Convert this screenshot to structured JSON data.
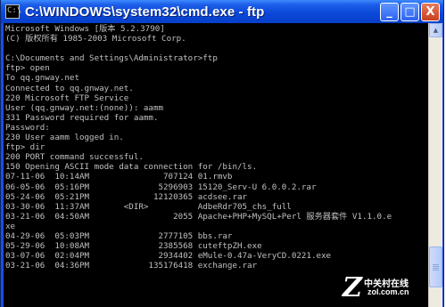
{
  "window": {
    "title": "C:\\WINDOWS\\system32\\cmd.exe - ftp",
    "icon_glyph": "C:\\",
    "minimize_symbol": "_",
    "maximize_symbol": "□",
    "close_symbol": "X"
  },
  "colors": {
    "titlebar": "#0a46d8",
    "console_background": "#000000",
    "console_text": "#c0c0c0",
    "close_button": "#c8401e"
  },
  "console": {
    "lines": [
      "Microsoft Windows [版本 5.2.3790]",
      "(C) 版权所有 1985-2003 Microsoft Corp.",
      "",
      "C:\\Documents and Settings\\Administrator>ftp",
      "ftp> open",
      "To qq.gnway.net",
      "Connected to qq.gnway.net.",
      "220 Microsoft FTP Service",
      "User (qq.gnway.net:(none)): aamm",
      "331 Password required for aamm.",
      "Password:",
      "230 User aamm logged in.",
      "ftp> dir",
      "200 PORT command successful.",
      "150 Opening ASCII mode data connection for /bin/ls.",
      "07-11-06  10:14AM               707124 01.rmvb",
      "06-05-06  05:16PM              5296903 15120_Serv-U 6.0.0.2.rar",
      "05-24-06  05:21PM             12120365 acdsee.rar",
      "03-30-06  11:37AM       <DIR>          AdbeRdr705_chs_full",
      "03-21-06  04:50AM                 2055 Apache+PHP+MySQL+Perl 服务器套件 V1.1.0.e",
      "xe",
      "04-29-06  05:03PM              2777105 bbs.rar",
      "05-29-06  10:08AM              2385568 cuteftpZH.exe",
      "03-07-06  02:04PM              2934402 eMule-0.47a-VeryCD.0221.exe",
      "03-21-06  04:36PM            135176418 exchange.rar"
    ]
  },
  "scrollbar": {
    "up_arrow_icon": "scroll-up-arrow-icon",
    "up_symbol": "▲"
  },
  "watermark": {
    "logo": "Z",
    "text_cn": "中关村在线",
    "site": "zol.com.cn"
  }
}
